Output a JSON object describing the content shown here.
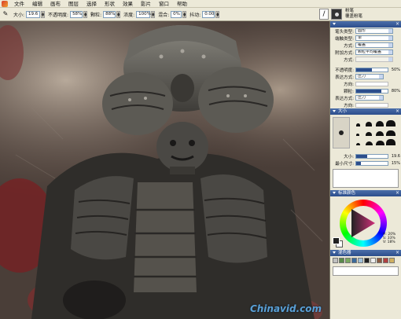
{
  "menubar": {
    "items": [
      "文件",
      "编辑",
      "画布",
      "图层",
      "选择",
      "形状",
      "效果",
      "影片",
      "窗口",
      "帮助"
    ]
  },
  "propbar": {
    "size_label": "大小:",
    "size_value": "19.6",
    "opacity_label": "不透明度:",
    "opacity_value": "58%",
    "grain_label": "颗粒:",
    "grain_value": "88%",
    "resat_label": "浓度:",
    "resat_value": "100%",
    "bleed_label": "混合:",
    "bleed_value": "0%",
    "jitter_label": "抖动:",
    "jitter_value": "0.00"
  },
  "brushsel": {
    "category": "粉笔",
    "variant": "覆盖粉笔"
  },
  "brush_controls": {
    "title": "",
    "rows": [
      {
        "k": "笔头类型:",
        "v": "圆形"
      },
      {
        "k": "端触类型:",
        "v": "单"
      },
      {
        "k": "方式:",
        "v": "覆盖"
      },
      {
        "k": "附加方式:",
        "v": "颗粒平均覆盖"
      },
      {
        "k": "方式:",
        "v": "",
        "disabled": true
      }
    ]
  },
  "opacity_panel": {
    "opacity_label": "不透明度:",
    "opacity_value": "50%",
    "opacity_fraction": 0.5,
    "expr_label": "表达方式:",
    "expr_value": "压力",
    "dir_label": "方向:",
    "grain_label": "颗粒:",
    "grain_value": "80%",
    "grain_fraction": 0.8,
    "expr2_label": "表达方式:",
    "expr2_value": "压力",
    "dir2_label": "方向:"
  },
  "size_panel": {
    "title": "大小",
    "size_label": "大小:",
    "size_value": "19.6",
    "size_fraction": 0.35,
    "min_label": "最小尺寸:",
    "min_value": "15%",
    "min_fraction": 0.15
  },
  "color_panel": {
    "title": "标准颜色",
    "h": "H: 20%",
    "s": "S: 33%",
    "v": "V: 18%"
  },
  "mixer_panel": {
    "title": "混色器",
    "colors": [
      "#c0c0c0",
      "#5a8a4a",
      "#7aa860",
      "#3c6a9a",
      "#a0c0d8",
      "#202020",
      "#f0f0f0",
      "#8a5a40",
      "#b04040",
      "#d0b060"
    ]
  },
  "watermark": "Chinavid.com"
}
